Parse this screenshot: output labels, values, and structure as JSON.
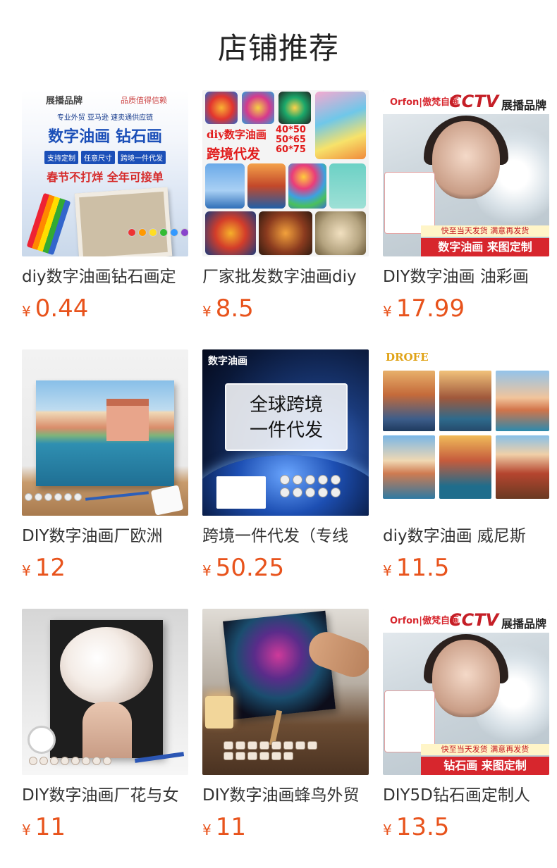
{
  "header": {
    "title": "店铺推荐"
  },
  "currency_symbol": "¥",
  "colors": {
    "price": "#e8531c",
    "title_text": "#333333",
    "background": "#ffffff"
  },
  "products": [
    {
      "title": "diy数字油画钻石画定",
      "price": "0.44",
      "image": {
        "brand": "展播品牌",
        "trust": "品质值得信赖",
        "subtitle": "专业外贸 亚马逊 速卖通供应链",
        "headline": "数字油画 钻石画",
        "tags": [
          "支持定制",
          "任意尺寸",
          "跨境一件代发"
        ],
        "slogan": "春节不打烊 全年可接单"
      }
    },
    {
      "title": "厂家批发数字油画diy",
      "price": "8.5",
      "image": {
        "line1": "diy数字油画",
        "line2": "跨境代发",
        "sizes": [
          "40*50",
          "50*65",
          "60*75"
        ]
      }
    },
    {
      "title": "DIY数字油画 油彩画",
      "price": "17.99",
      "image": {
        "logo": "Orfon|傲梵自画",
        "cctv": "CCTV",
        "brand": "展播品牌",
        "promo": "快至当天发货 满意再发货",
        "footer": "数字油画 来图定制"
      }
    },
    {
      "title": "DIY数字油画厂欧洲",
      "price": "12",
      "image": {}
    },
    {
      "title": "跨境一件代发（专线",
      "price": "50.25",
      "image": {
        "label": "数字油画",
        "line1": "全球跨境",
        "line2": "一件代发"
      }
    },
    {
      "title": "diy数字油画 威尼斯",
      "price": "11.5",
      "image": {
        "brand": "DROFE"
      }
    },
    {
      "title": "DIY数字油画厂花与女",
      "price": "11",
      "image": {}
    },
    {
      "title": "DIY数字油画蜂鸟外贸",
      "price": "11",
      "image": {}
    },
    {
      "title": "DIY5D钻石画定制人",
      "price": "13.5",
      "image": {
        "logo": "Orfon|傲梵自画",
        "cctv": "CCTV",
        "brand": "展播品牌",
        "promo": "快至当天发货 满意再发货",
        "footer": "钻石画 来图定制"
      }
    }
  ]
}
